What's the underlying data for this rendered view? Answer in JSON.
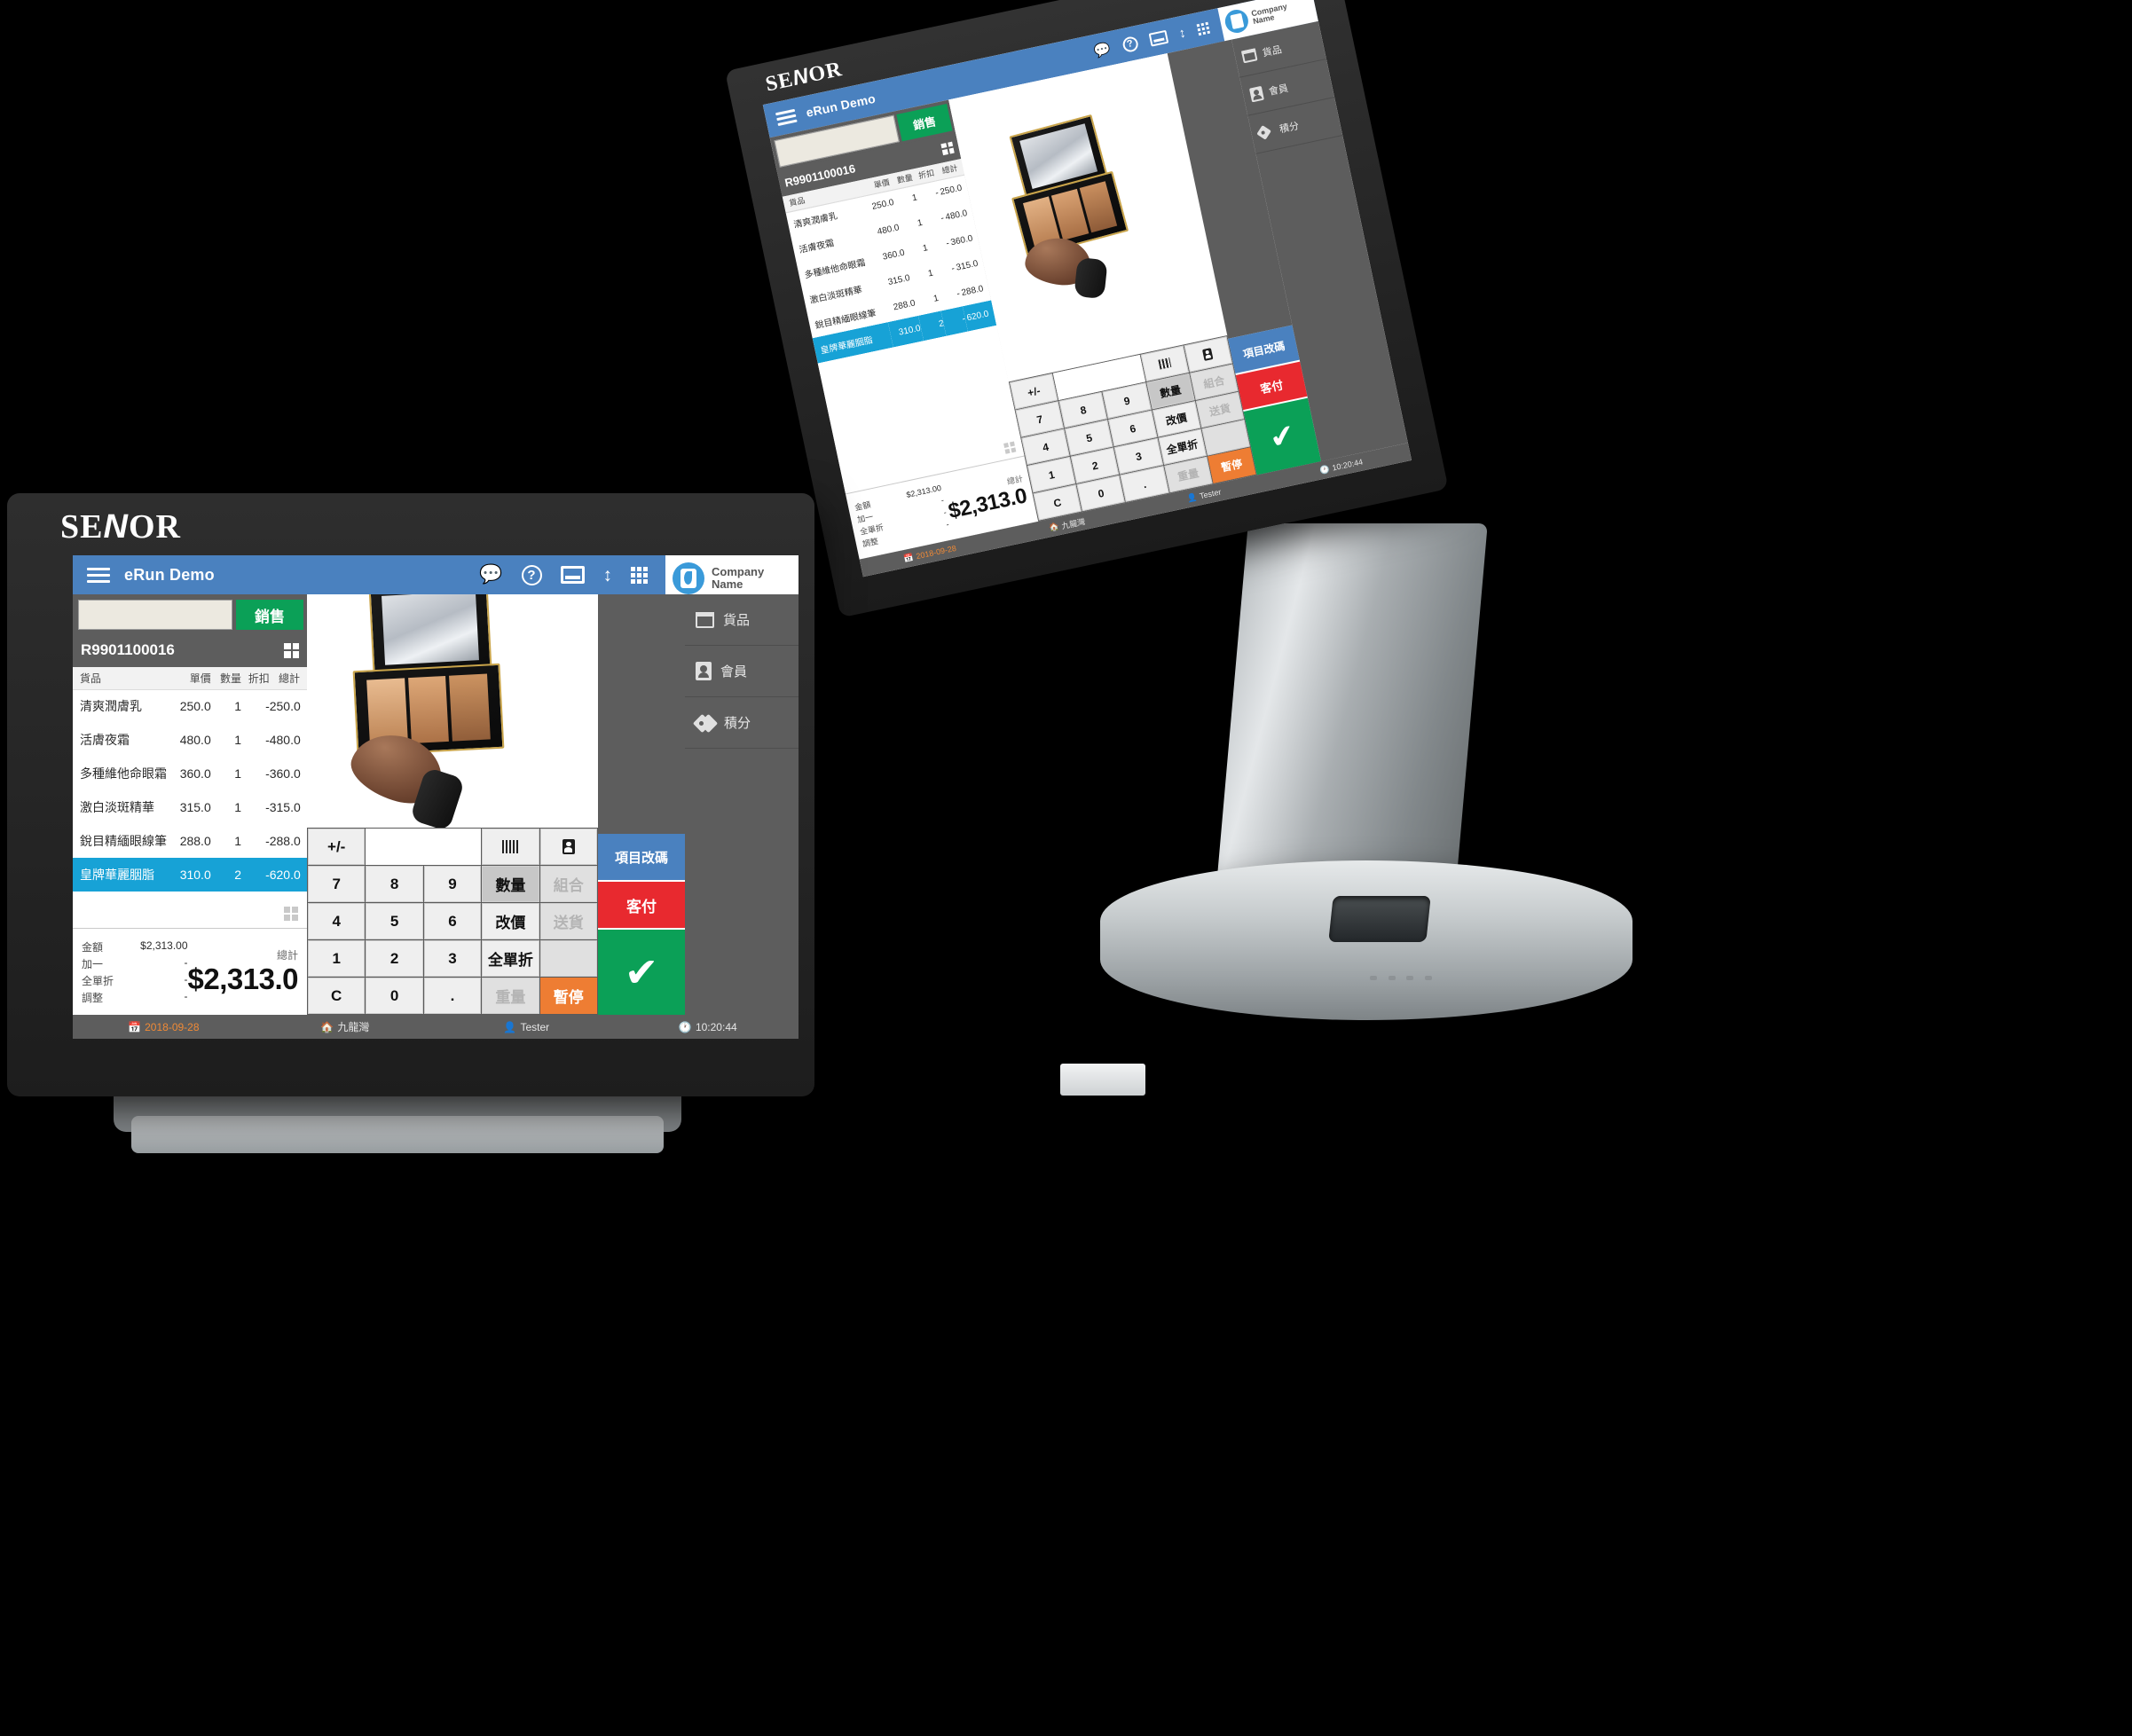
{
  "brand": {
    "logo_text": "SENOR",
    "logo_accent": "N"
  },
  "app": {
    "title": "eRun Demo",
    "company_line1": "Company",
    "company_line2": "Name",
    "accent_blue": "#4a81bf",
    "accent_green": "#0ba057",
    "accent_red": "#e8292f",
    "accent_orange": "#ee7d33",
    "selected_row_blue": "#17a2d6"
  },
  "toolbar": {
    "menu_icon": "hamburger-menu-icon",
    "icons": [
      {
        "name": "chat-icon",
        "glyph": "💬"
      },
      {
        "name": "help-icon",
        "glyph": "?"
      },
      {
        "name": "window-icon",
        "glyph": "▤"
      },
      {
        "name": "sort-updown-icon",
        "glyph": "↕"
      },
      {
        "name": "grid-apps-icon",
        "glyph": "∷"
      }
    ]
  },
  "search": {
    "value": "",
    "placeholder": ""
  },
  "sell_button": "銷售",
  "document": {
    "number": "R9901100016"
  },
  "cart": {
    "columns": [
      "貨品",
      "單價",
      "數量",
      "折扣",
      "總計"
    ],
    "rows": [
      {
        "name": "清爽潤膚乳",
        "price": "250.0",
        "qty": "1",
        "disc": "-",
        "total": "250.0",
        "selected": false
      },
      {
        "name": "活膚夜霜",
        "price": "480.0",
        "qty": "1",
        "disc": "-",
        "total": "480.0",
        "selected": false
      },
      {
        "name": "多種維他命眼霜",
        "price": "360.0",
        "qty": "1",
        "disc": "-",
        "total": "360.0",
        "selected": false
      },
      {
        "name": "激白淡斑精華",
        "price": "315.0",
        "qty": "1",
        "disc": "-",
        "total": "315.0",
        "selected": false
      },
      {
        "name": "銳目精緬眼線筆",
        "price": "288.0",
        "qty": "1",
        "disc": "-",
        "total": "288.0",
        "selected": false
      },
      {
        "name": "皇牌華麗胭脂",
        "price": "310.0",
        "qty": "2",
        "disc": "-",
        "total": "620.0",
        "selected": true
      }
    ]
  },
  "totals": {
    "lines": [
      {
        "label": "金額",
        "value": "$2,313.00"
      },
      {
        "label": "加一",
        "value": "-"
      },
      {
        "label": "全單折",
        "value": "-"
      },
      {
        "label": "調整",
        "value": "-"
      }
    ],
    "grand_label": "總計",
    "grand_value": "$2,313.0"
  },
  "keypad": {
    "rows": [
      [
        {
          "label": "+/-",
          "style": "normal"
        },
        {
          "label": "",
          "style": "blank",
          "span": 2
        },
        {
          "label": "",
          "style": "normal",
          "icon": "barcode-icon"
        },
        {
          "label": "",
          "style": "normal",
          "icon": "contact-card-icon"
        }
      ],
      [
        {
          "label": "7",
          "style": "normal"
        },
        {
          "label": "8",
          "style": "normal"
        },
        {
          "label": "9",
          "style": "normal"
        },
        {
          "label": "數量",
          "style": "active"
        },
        {
          "label": "組合",
          "style": "disabled"
        }
      ],
      [
        {
          "label": "4",
          "style": "normal"
        },
        {
          "label": "5",
          "style": "normal"
        },
        {
          "label": "6",
          "style": "normal"
        },
        {
          "label": "改價",
          "style": "normal"
        },
        {
          "label": "送貨",
          "style": "disabled"
        }
      ],
      [
        {
          "label": "1",
          "style": "normal"
        },
        {
          "label": "2",
          "style": "normal"
        },
        {
          "label": "3",
          "style": "normal"
        },
        {
          "label": "全單折",
          "style": "normal"
        },
        {
          "label": "",
          "style": "disabled"
        }
      ],
      [
        {
          "label": "C",
          "style": "normal"
        },
        {
          "label": "0",
          "style": "normal"
        },
        {
          "label": ".",
          "style": "normal"
        },
        {
          "label": "重量",
          "style": "disabled"
        },
        {
          "label": "暫停",
          "style": "orange"
        }
      ]
    ]
  },
  "sidekeys": [
    {
      "label": "項目改碼",
      "style": "blue"
    },
    {
      "label": "客付",
      "style": "red"
    },
    {
      "label": "✔",
      "style": "green",
      "icon": "checkmark-icon"
    }
  ],
  "menu": [
    {
      "label": "貨品",
      "icon": "box-icon"
    },
    {
      "label": "會員",
      "icon": "contact-book-icon"
    },
    {
      "label": "積分",
      "icon": "tag-icon"
    }
  ],
  "statusbar": {
    "date": "2018-09-28",
    "date_icon": "calendar-icon",
    "location": "九龍灣",
    "location_icon": "home-icon",
    "user": "Tester",
    "user_icon": "user-icon",
    "time": "10:20:44",
    "time_icon": "clock-icon"
  }
}
